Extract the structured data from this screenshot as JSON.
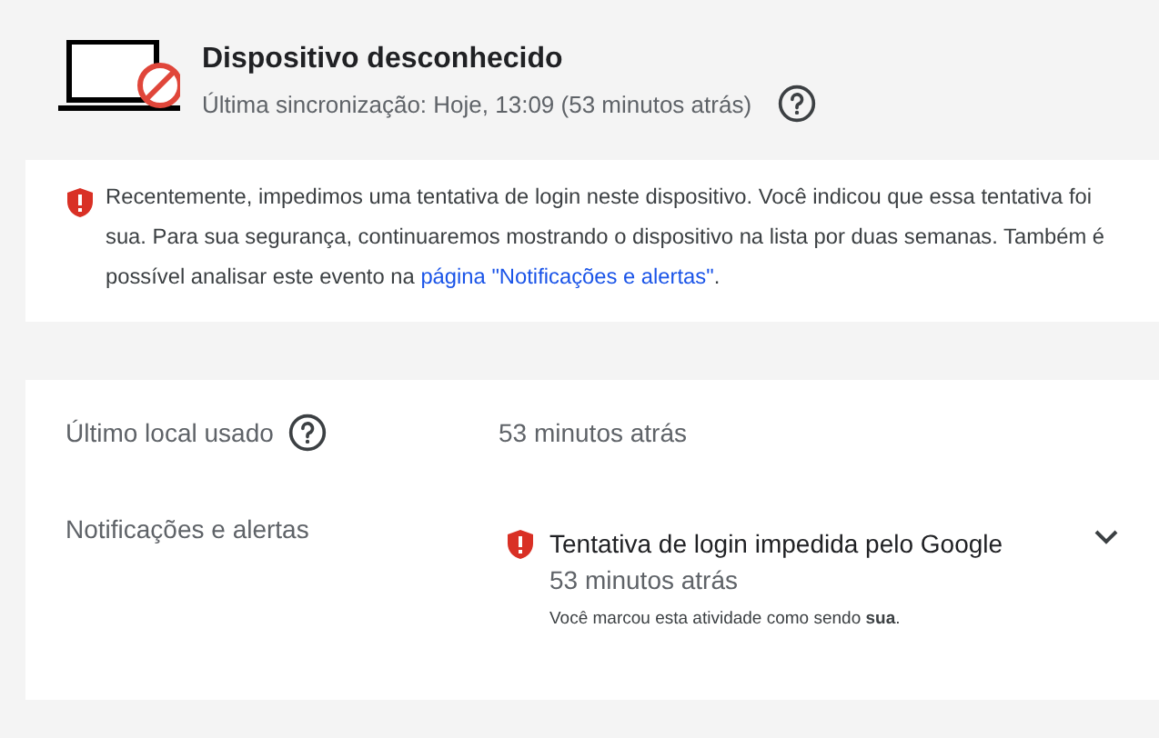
{
  "device": {
    "title": "Dispositivo desconhecido",
    "last_sync": "Última sincronização: Hoje, 13:09 (53 minutos atrás)"
  },
  "notice": {
    "text": "Recentemente, impedimos uma tentativa de login neste dispositivo. Você indicou que essa tentativa foi sua. Para sua segurança, continuaremos mostrando o dispositivo na lista por duas semanas. Também é possível analisar este evento na ",
    "link": "página \"Notificações e alertas\"",
    "text_after": "."
  },
  "details": [
    {
      "kind": "value",
      "label": "Último local usado",
      "help": true,
      "value": "53 minutos atrás"
    },
    {
      "kind": "alert",
      "label": "Notificações e alertas",
      "alert_title": "Tentativa de login impedida pelo Google",
      "time": "53 minutos atrás",
      "note": "Você marcou esta atividade como sendo **sua**.",
      "expanded": false
    }
  ]
}
